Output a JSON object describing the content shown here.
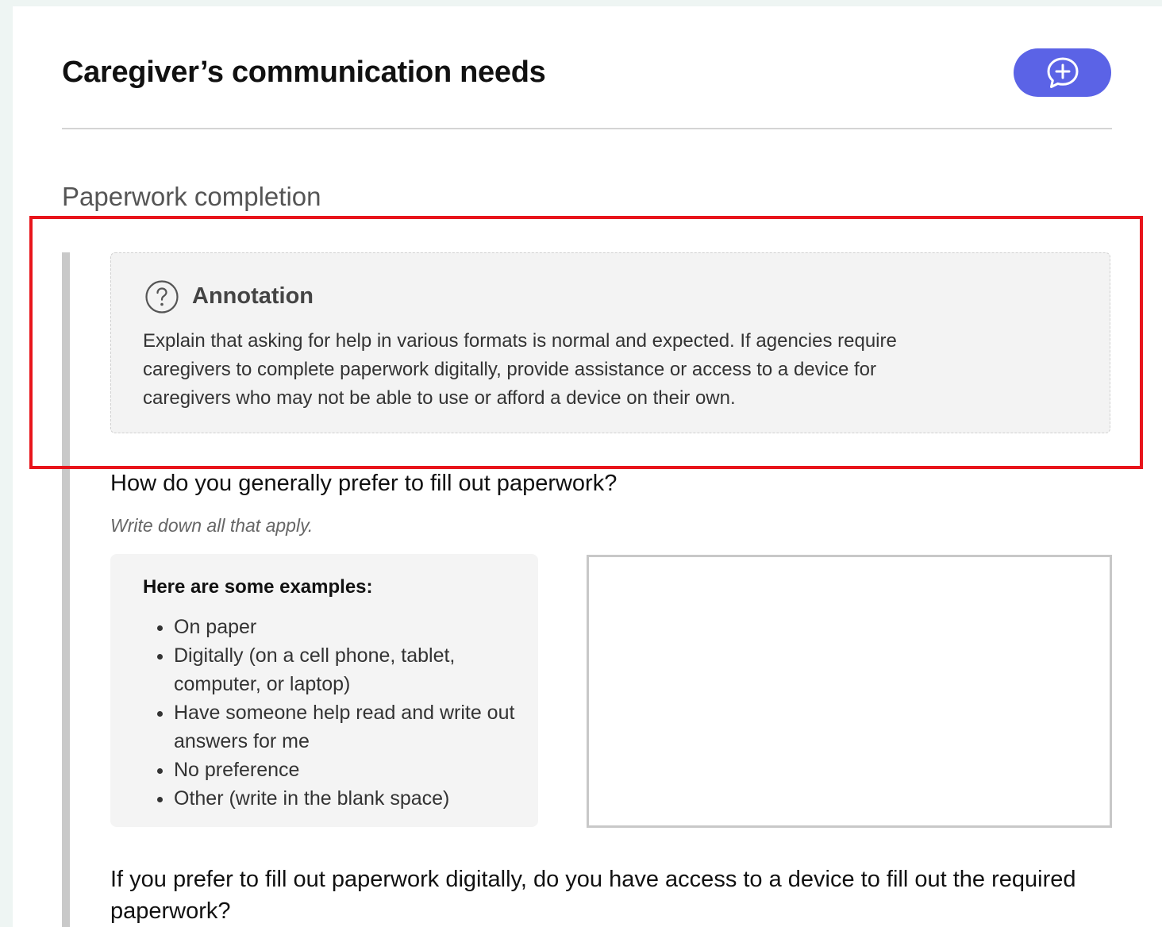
{
  "header": {
    "title": "Caregiver’s communication needs",
    "chat_button_icon": "chat-add-icon",
    "accent_color": "#5b63e6"
  },
  "section": {
    "title": "Paperwork completion"
  },
  "annotation": {
    "icon": "help-circle-icon",
    "title": "Annotation",
    "lines": [
      "Explain that asking for help in various formats is normal and expected. If agencies require",
      "caregivers to complete paperwork digitally, provide assistance or access to a device for",
      "caregivers who may not be able to use or afford a device on their own."
    ],
    "highlight_color": "#e8141b"
  },
  "question1": {
    "text": "How do you generally prefer to fill out paperwork?",
    "hint": "Write down all that apply.",
    "answer_value": ""
  },
  "examples": {
    "heading": "Here are some examples:",
    "items": [
      "On paper",
      "Digitally (on a cell phone, tablet, computer, or laptop)",
      "Have someone help read and write out answers for me",
      "No preference",
      "Other (write in the blank space)"
    ]
  },
  "question2": {
    "text": "If you prefer to fill out paperwork digitally, do you have access to a device to fill out the required paperwork?"
  }
}
